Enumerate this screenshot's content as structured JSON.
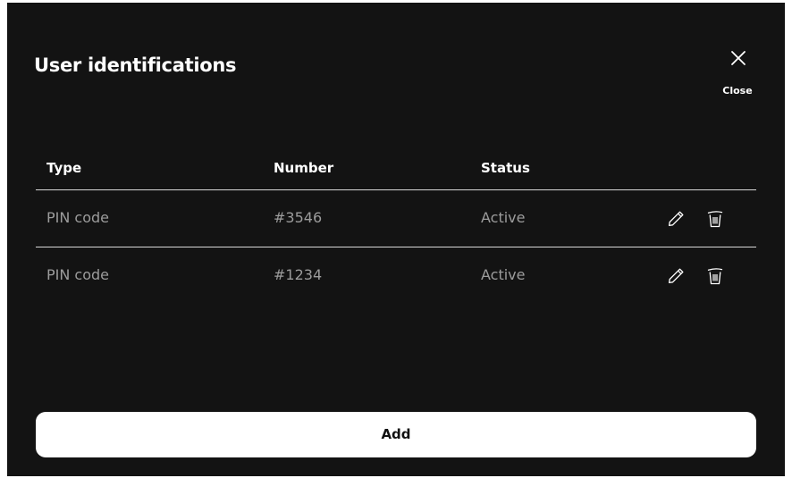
{
  "dialog": {
    "title": "User identifications",
    "close_label": "Close"
  },
  "table": {
    "columns": [
      "Type",
      "Number",
      "Status"
    ],
    "rows": [
      {
        "type": "PIN code",
        "number": "#3546",
        "status": "Active",
        "actions": [
          "pencil-icon",
          "trash-icon"
        ]
      },
      {
        "type": "PIN code",
        "number": "#1234",
        "status": "Active",
        "actions": [
          "pencil-icon",
          "trash-icon"
        ]
      }
    ]
  },
  "add_button": {
    "label": "Add"
  },
  "colors": {
    "background": "#131313",
    "text_primary": "#ffffff",
    "text_secondary": "#9c9c9c",
    "divider": "#d8d8d8",
    "button_background": "#ffffff",
    "button_text": "#111111"
  }
}
